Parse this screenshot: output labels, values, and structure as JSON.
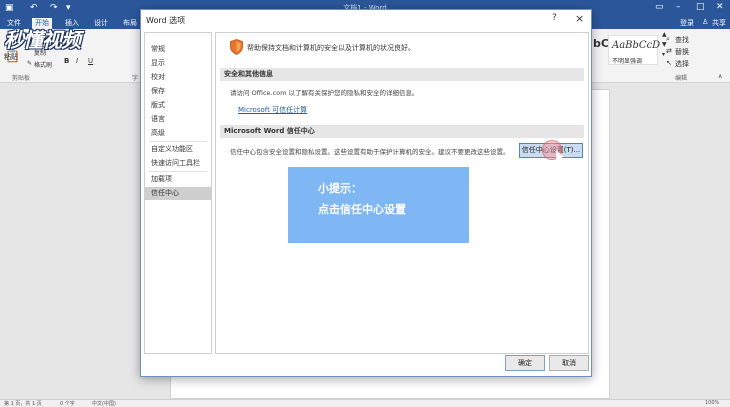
{
  "word": {
    "window_title": "文档1 - Word",
    "tabs": [
      "文件",
      "开始",
      "插入",
      "设计",
      "布局"
    ],
    "active_tab_index": 1,
    "login": "登录",
    "share": "共享",
    "ribbon": {
      "paste": "粘贴",
      "copy": "复制",
      "format_painter": "格式刷",
      "clipboard_group": "剪贴板",
      "font_group_fragment": "字",
      "bold": "B",
      "italic": "I",
      "underline": "U",
      "find": "查找",
      "replace": "替换",
      "select": "选择",
      "edit_group": "编辑",
      "style_1_sample": "AaBbCcD",
      "style_1_name": "",
      "style_2_sample": "AaBbCcD",
      "style_2_name": "不明显强调",
      "style_partial": "bC"
    },
    "status": {
      "page": "第 1 页，共 1 页",
      "words": "0 个字",
      "language": "中文(中国)",
      "zoom": "100%"
    }
  },
  "watermark": "秒懂视频",
  "dialog": {
    "title": "Word 选项",
    "help": "?",
    "close": "×",
    "nav": [
      "常规",
      "显示",
      "校对",
      "保存",
      "版式",
      "语言",
      "高级",
      "自定义功能区",
      "快速访问工具栏",
      "加载项",
      "信任中心"
    ],
    "selected_nav_index": 10,
    "intro": "帮助保持文档和计算机的安全以及计算机的状况良好。",
    "section1_header": "安全和其他信息",
    "section1_text": "请访问 Office.com 以了解有关保护您的隐私和安全的详细信息。",
    "section1_link": "Microsoft 可信任计算",
    "section2_header": "Microsoft Word 信任中心",
    "section2_text": "信任中心包含安全设置和隐私设置。这些设置有助于保护计算机的安全。建议不要更改这些设置。",
    "trust_center_button": "信任中心设置(T)...",
    "ok": "确定",
    "cancel": "取消"
  },
  "tip": {
    "line1": "小提示：",
    "line2": "点击信任中心设置"
  },
  "colors": {
    "word_blue": "#2b579a",
    "tip_blue": "#7fb7f5",
    "link_blue": "#1f5fa8",
    "nav_selected": "#cfcfcf"
  }
}
